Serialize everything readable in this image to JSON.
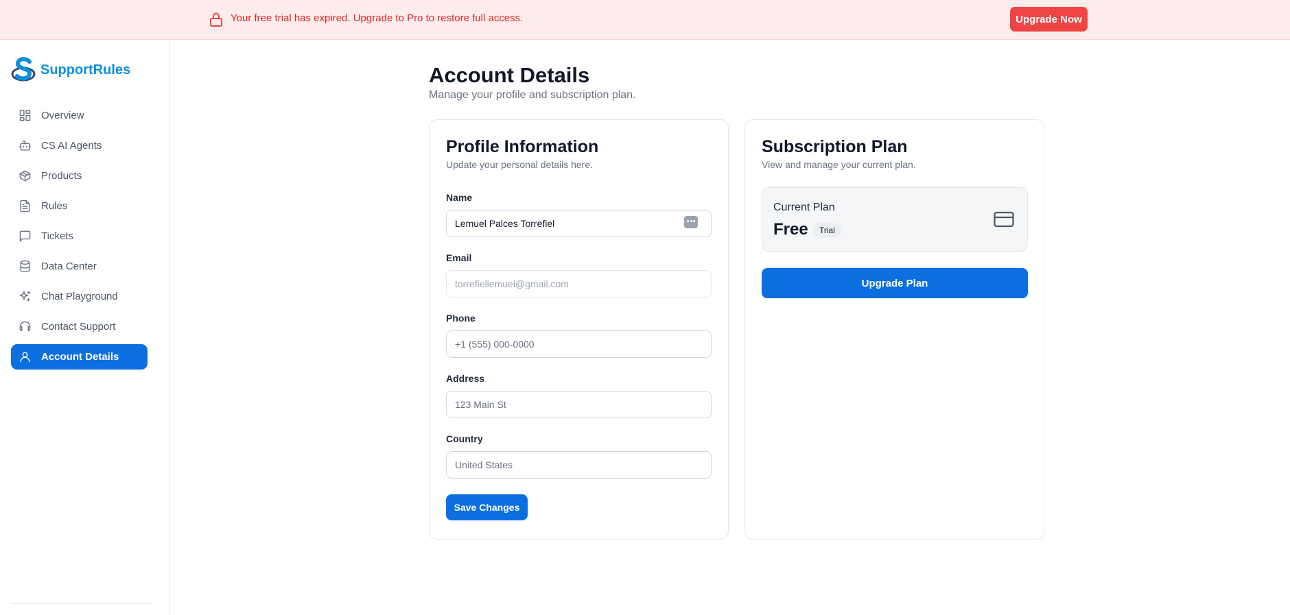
{
  "banner": {
    "message": "Your free trial has expired. Upgrade to Pro to restore full access.",
    "button_label": "Upgrade Now",
    "icon": "lock-icon",
    "color": "#ef4444"
  },
  "brand": {
    "name": "SupportRules",
    "color": "#0b8fe0"
  },
  "sidebar": {
    "items": [
      {
        "label": "Overview",
        "icon": "grid-icon",
        "active": false
      },
      {
        "label": "CS AI Agents",
        "icon": "bot-icon",
        "active": false
      },
      {
        "label": "Products",
        "icon": "box-icon",
        "active": false
      },
      {
        "label": "Rules",
        "icon": "document-icon",
        "active": false
      },
      {
        "label": "Tickets",
        "icon": "chat-bubble-icon",
        "active": false
      },
      {
        "label": "Data Center",
        "icon": "database-icon",
        "active": false
      },
      {
        "label": "Chat Playground",
        "icon": "sparkles-icon",
        "active": false
      },
      {
        "label": "Contact Support",
        "icon": "headset-icon",
        "active": false
      },
      {
        "label": "Account Details",
        "icon": "user-icon",
        "active": true
      }
    ],
    "active_color": "#0b6fe0"
  },
  "page": {
    "title": "Account Details",
    "subtitle": "Manage your profile and subscription plan."
  },
  "profile": {
    "title": "Profile Information",
    "description": "Update your personal details here.",
    "fields": {
      "name": {
        "label": "Name",
        "value": "Lemuel Palces Torrefiel",
        "placeholder": ""
      },
      "email": {
        "label": "Email",
        "value": "torrefiellemuel@gmail.com",
        "placeholder": ""
      },
      "phone": {
        "label": "Phone",
        "value": "",
        "placeholder": "+1 (555) 000-0000"
      },
      "address": {
        "label": "Address",
        "value": "",
        "placeholder": "123 Main St"
      },
      "country": {
        "label": "Country",
        "value": "",
        "placeholder": "United States"
      }
    },
    "save_label": "Save Changes"
  },
  "subscription": {
    "title": "Subscription Plan",
    "description": "View and manage your current plan.",
    "current_plan_caption": "Current Plan",
    "plan_name": "Free",
    "plan_badge": "Trial",
    "plan_icon": "credit-card-icon",
    "upgrade_label": "Upgrade Plan"
  }
}
